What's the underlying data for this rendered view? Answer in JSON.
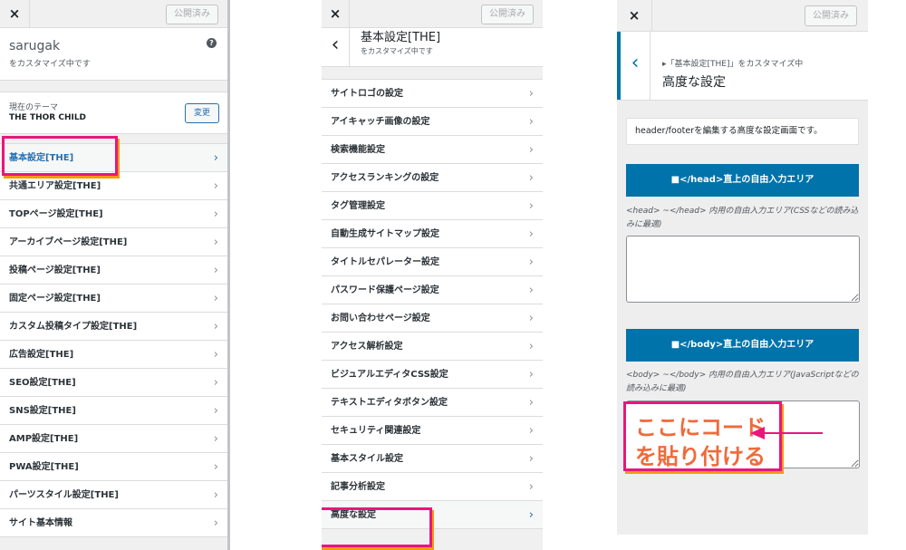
{
  "panel1": {
    "close_icon": "×",
    "publish_label": "公開済み",
    "site_name": "sarugak",
    "customizing_label": "をカスタマイズ中です",
    "help_icon": "?",
    "theme_caption": "現在のテーマ",
    "theme_name": "THE THOR CHILD",
    "change_button": "変更",
    "items": [
      {
        "label": "基本設定[THE]"
      },
      {
        "label": "共通エリア設定[THE]"
      },
      {
        "label": "TOPページ設定[THE]"
      },
      {
        "label": "アーカイブページ設定[THE]"
      },
      {
        "label": "投稿ページ設定[THE]"
      },
      {
        "label": "固定ページ設定[THE]"
      },
      {
        "label": "カスタム投稿タイプ設定[THE]"
      },
      {
        "label": "広告設定[THE]"
      },
      {
        "label": "SEO設定[THE]"
      },
      {
        "label": "SNS設定[THE]"
      },
      {
        "label": "AMP設定[THE]"
      },
      {
        "label": "PWA設定[THE]"
      },
      {
        "label": "パーツスタイル設定[THE]"
      },
      {
        "label": "サイト基本情報"
      }
    ],
    "chevron": "›"
  },
  "panel2": {
    "close_icon": "×",
    "publish_label": "公開済み",
    "back_icon": "‹",
    "section_title": "基本設定[THE]",
    "customizing_label": "をカスタマイズ中です",
    "items": [
      {
        "label": "サイトロゴの設定"
      },
      {
        "label": "アイキャッチ画像の設定"
      },
      {
        "label": "検索機能設定"
      },
      {
        "label": "アクセスランキングの設定"
      },
      {
        "label": "タグ管理設定"
      },
      {
        "label": "自動生成サイトマップ設定"
      },
      {
        "label": "タイトルセパレーター設定"
      },
      {
        "label": "パスワード保護ページ設定"
      },
      {
        "label": "お問い合わせページ設定"
      },
      {
        "label": "アクセス解析設定"
      },
      {
        "label": "ビジュアルエディタCSS設定"
      },
      {
        "label": "テキストエディタボタン設定"
      },
      {
        "label": "セキュリティ関連設定"
      },
      {
        "label": "基本スタイル設定"
      },
      {
        "label": "記事分析設定"
      },
      {
        "label": "高度な設定"
      }
    ],
    "chevron": "›"
  },
  "panel3": {
    "close_icon": "×",
    "publish_label": "公開済み",
    "back_icon": "‹",
    "breadcrumb": "▸「基本設定[THE]」をカスタマイズ中",
    "title": "高度な設定",
    "description": "header/footerを編集する高度な設定画面です。",
    "head_heading": "■</head>直上の自由入力エリア",
    "head_help": "<head> ~</head> 内用の自由入力エリア(CSSなどの読み込みに最適)",
    "head_value": "",
    "body_heading": "■</body>直上の自由入力エリア",
    "body_help": "<body> ~</body> 内用の自由入力エリア(JavaScriptなどの読み込みに最適)",
    "body_value": ""
  },
  "annotation": {
    "callout_line1": "ここにコード",
    "callout_line2": "を貼り付ける",
    "arrow_icon": "arrow-left"
  },
  "colors": {
    "accent_blue": "#0073aa",
    "link_blue": "#2271b1",
    "highlight_pink": "#e8177a",
    "highlight_orange": "#f39a10",
    "callout_text": "#f06a3a"
  }
}
